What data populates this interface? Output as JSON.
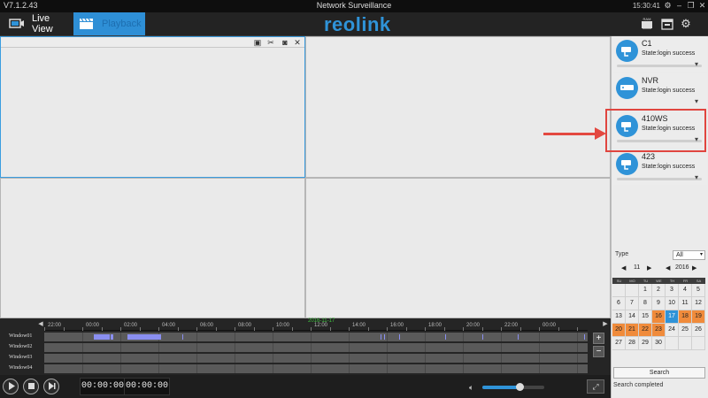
{
  "app": {
    "version": "V7.1.2.43",
    "title": "Network Surveillance",
    "clock": "15:30:41",
    "logo": "reolink"
  },
  "tabs": [
    {
      "label": "Live View",
      "icon": "live-view-icon"
    },
    {
      "label": "Playback",
      "icon": "playback-clapper-icon"
    }
  ],
  "top_icons": [
    "ram-icon",
    "calendar-icon",
    "gear-icon"
  ],
  "colors": {
    "accent": "#2f93d8",
    "record": "#f08b3b",
    "highlight": "#e0453f"
  },
  "devices": [
    {
      "name": "C1",
      "state": "State:login success",
      "icon": "camera-icon"
    },
    {
      "name": "NVR",
      "state": "State:login success",
      "icon": "nvr-icon"
    },
    {
      "name": "410WS",
      "state": "State:login success",
      "icon": "camera-icon"
    },
    {
      "name": "423",
      "state": "State:login success",
      "icon": "camera-icon"
    }
  ],
  "search_panel": {
    "type_label": "Type",
    "type_value": "All",
    "month": "11",
    "year": "2016",
    "weekdays": [
      "SU",
      "MO",
      "TU",
      "WE",
      "TH",
      "FR",
      "SA"
    ],
    "weeks": [
      [
        "",
        "",
        "1",
        "2",
        "3",
        "4",
        "5"
      ],
      [
        "6",
        "7",
        "8",
        "9",
        "10",
        "11",
        "12"
      ],
      [
        "13",
        "14",
        "15",
        "16",
        "17",
        "18",
        "19"
      ],
      [
        "20",
        "21",
        "22",
        "23",
        "24",
        "25",
        "26"
      ],
      [
        "27",
        "28",
        "29",
        "30",
        "",
        "",
        ""
      ]
    ],
    "record_days": [
      "16",
      "18",
      "19",
      "20",
      "21",
      "22",
      "23"
    ],
    "selected_day": "17",
    "search_label": "Search",
    "status": "Search completed"
  },
  "timeline": {
    "date": "2016-11-17",
    "hours": [
      "22:00",
      "00:00",
      "02:00",
      "04:00",
      "06:00",
      "08:00",
      "10:00",
      "12:00",
      "14:00",
      "16:00",
      "18:00",
      "20:00",
      "22:00",
      "00:00"
    ],
    "channels": [
      "Window01",
      "Window02",
      "Window03",
      "Window04"
    ]
  },
  "playback": {
    "start_time": "00:00:00",
    "end_time": "00:00:00",
    "volume": 0.6
  }
}
